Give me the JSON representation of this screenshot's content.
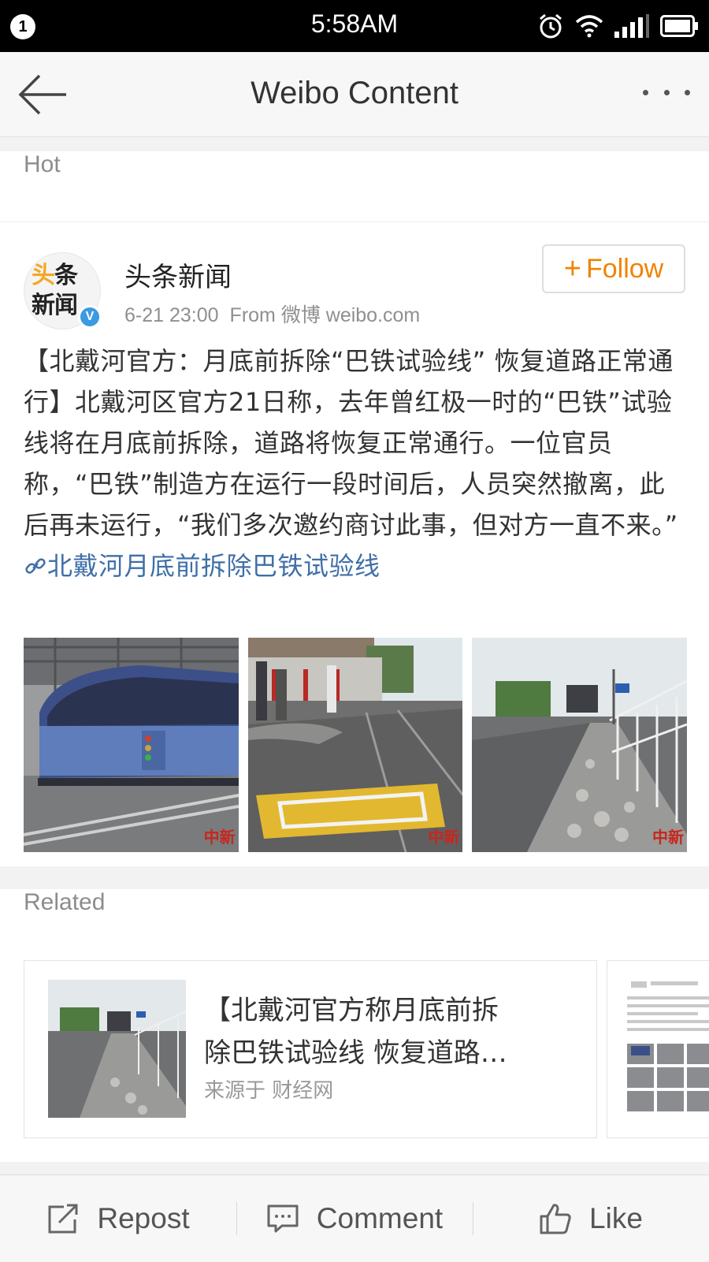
{
  "status_bar": {
    "notification_count": "1",
    "time": "5:58AM"
  },
  "nav": {
    "title": "Weibo Content"
  },
  "hot": {
    "section_label": "Hot",
    "post": {
      "author": "头条新闻",
      "avatar_text_line1_hl": "头",
      "avatar_text_line1": "条",
      "avatar_text_line2": "新闻",
      "verified_mark": "V",
      "time": "6-21 23:00",
      "source": "From 微博 weibo.com",
      "follow_label": "Follow",
      "text": "【北戴河官方：月底前拆除“巴铁试验线” 恢复道路正常通行】北戴河区官方21日称，去年曾红极一时的“巴铁”试验线将在月底前拆除，道路将恢复正常通行。一位官员称，“巴铁”制造方在运行一段时间后，人员突然撤离，此后再未运行，“我们多次邀约商讨此事，但对方一直不来。”",
      "link_text": "北戴河月底前拆除巴铁试验线",
      "photo_watermark": "中新"
    }
  },
  "related": {
    "section_label": "Related",
    "card": {
      "title_line1": "【北戴河官方称月底前拆",
      "title_line2": "除巴铁试验线 恢复道路…",
      "source": "来源于 财经网"
    }
  },
  "toolbar": {
    "repost_label": "Repost",
    "comment_label": "Comment",
    "like_label": "Like"
  }
}
